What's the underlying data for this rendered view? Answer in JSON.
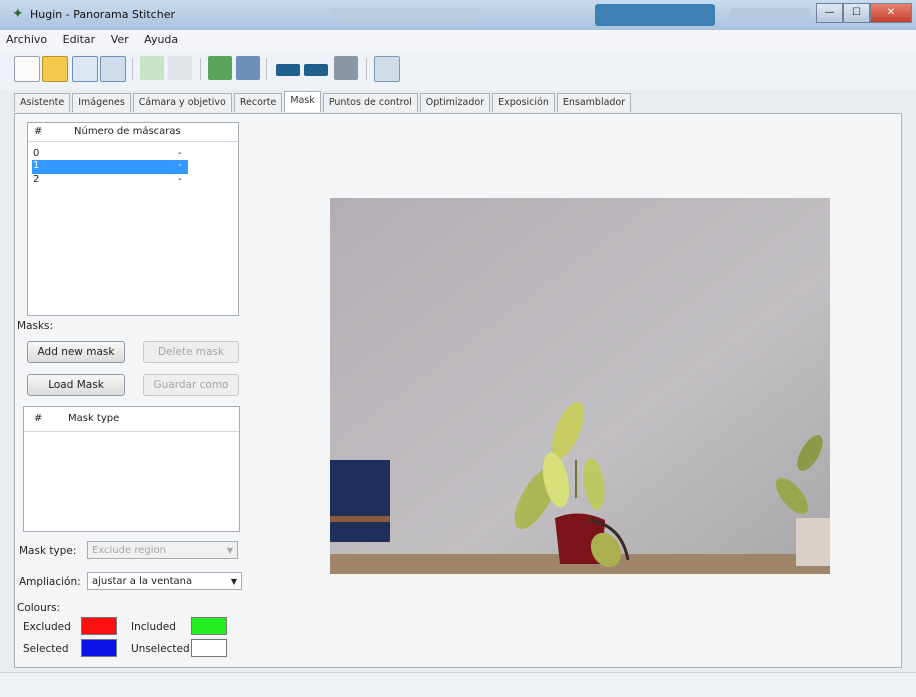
{
  "window": {
    "title": "Hugin - Panorama Stitcher",
    "controls": [
      "—",
      "☐",
      "✕"
    ]
  },
  "menu": [
    "Archivo",
    "Editar",
    "Ver",
    "Ayuda"
  ],
  "tabs": [
    {
      "label": "Asistente"
    },
    {
      "label": "Imágenes"
    },
    {
      "label": "Cámara y objetivo"
    },
    {
      "label": "Recorte"
    },
    {
      "label": "Mask"
    },
    {
      "label": "Puntos de control"
    },
    {
      "label": "Optimizador"
    },
    {
      "label": "Exposición"
    },
    {
      "label": "Ensamblador"
    }
  ],
  "images_list": {
    "col_index": "#",
    "col_masks": "Número de máscaras",
    "rows": [
      {
        "index": "0",
        "masks": "-"
      },
      {
        "index": "1",
        "masks": "-"
      },
      {
        "index": "2",
        "masks": "-"
      }
    ]
  },
  "mask_panel": {
    "label": "Masks:",
    "add": "Add new mask",
    "delete": "Delete mask",
    "load": "Load Mask",
    "save": "Guardar como",
    "col_index": "#",
    "col_type": "Mask type",
    "type_label": "Mask type:",
    "type_value": "Exclude region",
    "zoom_label": "Ampliación:",
    "zoom_value": "ajustar a la ventana"
  },
  "colours": {
    "label": "Colours:",
    "excluded": "Excluded",
    "included": "Included",
    "selected": "Selected",
    "unselected": "Unselected",
    "excluded_color": "#ff1010",
    "included_color": "#22ee22",
    "selected_color": "#0a14e6",
    "unselected_color": "#ffffff"
  }
}
